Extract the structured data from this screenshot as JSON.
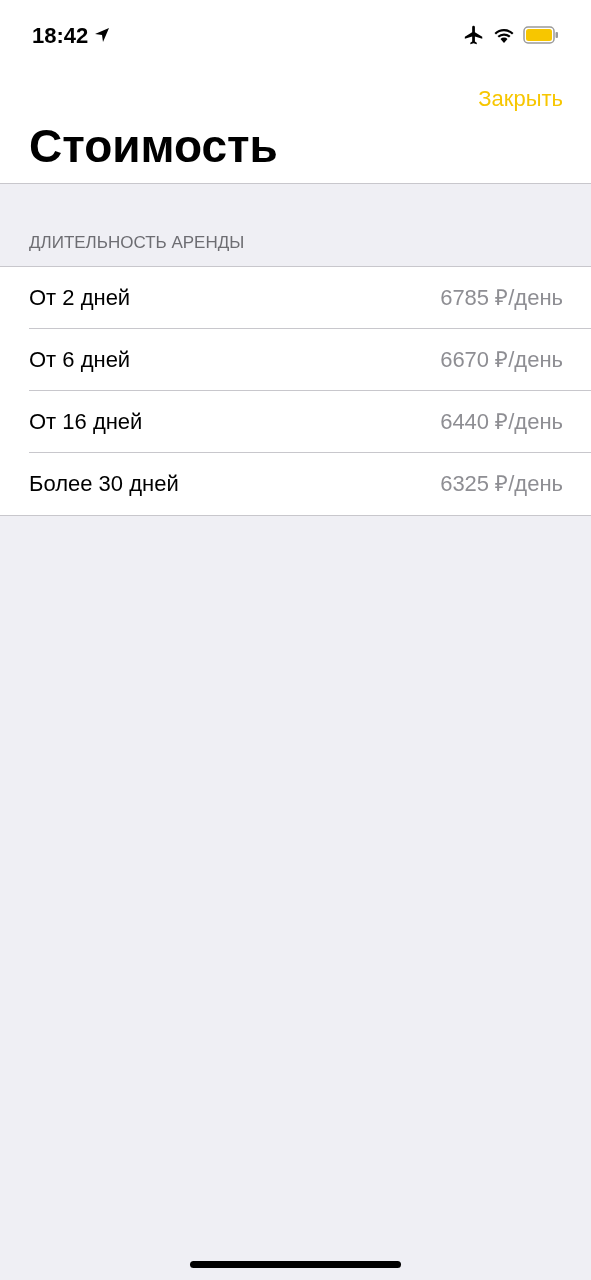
{
  "status_bar": {
    "time": "18:42"
  },
  "nav": {
    "close": "Закрыть",
    "title": "Стоимость"
  },
  "section": {
    "header": "ДЛИТЕЛЬНОСТЬ АРЕНДЫ",
    "rows": [
      {
        "label": "От 2 дней",
        "value": "6785 ₽/день"
      },
      {
        "label": "От 6 дней",
        "value": "6670 ₽/день"
      },
      {
        "label": "От 16 дней",
        "value": "6440 ₽/день"
      },
      {
        "label": "Более 30 дней",
        "value": "6325 ₽/день"
      }
    ]
  }
}
